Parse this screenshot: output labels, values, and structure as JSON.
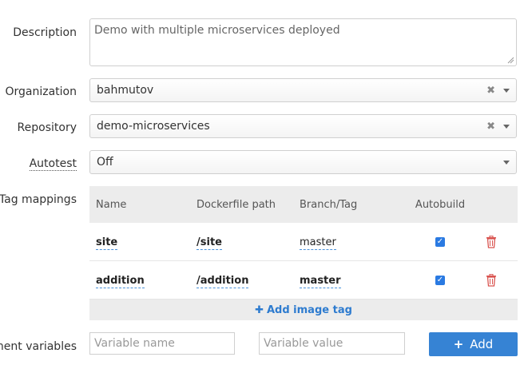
{
  "form": {
    "description": {
      "label": "Description",
      "value": "Demo with multiple microservices deployed"
    },
    "organization": {
      "label": "Organization",
      "value": "bahmutov"
    },
    "repository": {
      "label": "Repository",
      "value": "demo-microservices"
    },
    "autotest": {
      "label": "Autotest",
      "value": "Off"
    },
    "tag_mappings": {
      "label": "Tag mappings",
      "columns": [
        "Name",
        "Dockerfile path",
        "Branch/Tag",
        "Autobuild"
      ],
      "rows": [
        {
          "name": "site",
          "path": "/site",
          "branch": "master",
          "autobuild": true
        },
        {
          "name": "addition",
          "path": "/addition",
          "branch": "master",
          "autobuild": true
        }
      ],
      "add_label": "Add image tag"
    },
    "env_vars": {
      "label": "ment variables",
      "name_placeholder": "Variable name",
      "value_placeholder": "Variable value",
      "add_label": "Add"
    }
  },
  "colors": {
    "accent": "#3683d4",
    "delete": "#d9534f"
  },
  "icons": [
    "clear-icon",
    "caret-down-icon",
    "checkbox-icon",
    "trash-icon",
    "plus-icon",
    "resize-grip-icon"
  ]
}
